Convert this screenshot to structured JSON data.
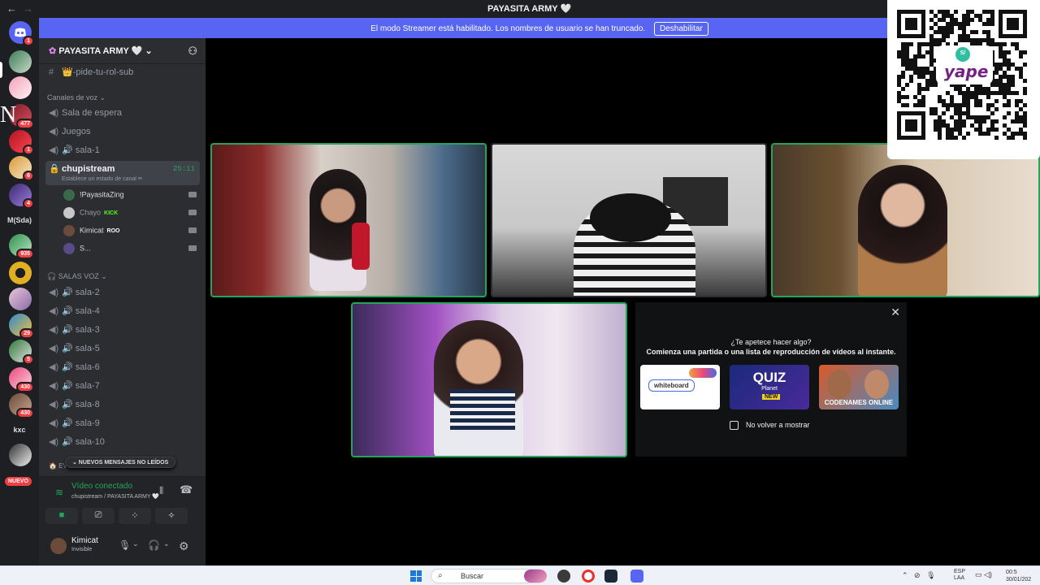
{
  "titlebar": {
    "title": "PAYASITA ARMY 🤍",
    "back": "←",
    "forward": "→"
  },
  "banner": {
    "text": "El modo Streamer está habilitado. Los nombres de usuario se han truncado.",
    "button": "Deshabilitar"
  },
  "guilds": {
    "badges": [
      "1",
      "477",
      "1",
      "6",
      "4",
      "935",
      "29",
      "5",
      "430",
      "430"
    ],
    "texts": [
      "M(Sda)",
      "kxc"
    ],
    "nuevo": "NUEVO",
    "overlay_letter": "N"
  },
  "server": {
    "name": "PAYASITA ARMY 🤍 ⌄"
  },
  "channels": {
    "top_channel": "👑-pide-tu-rol-sub",
    "category_voice": "Canales de voz ⌄",
    "waiting": "Sala de espera",
    "games": "Juegos",
    "sala1": "🔊 sala-1",
    "active": {
      "name": "chupistream",
      "status": "Establece un estado de canal ✏",
      "time": "25:11"
    },
    "users": [
      {
        "name": "!PayasitaZing",
        "tag": ""
      },
      {
        "name": "Chayo",
        "tag": "KICK"
      },
      {
        "name": "Kimicat",
        "tag": "ROO"
      },
      {
        "name": "S...",
        "tag": ""
      }
    ],
    "category_salas": "🎧 SALAS VOZ ⌄",
    "salas": [
      "🔊 sala-2",
      "🔊 sala-4",
      "🔊 sala-3",
      "🔊 sala-5",
      "🔊 sala-6",
      "🔊 sala-7",
      "🔊 sala-8",
      "🔊 sala-9",
      "🔊 sala-10"
    ],
    "unread": "⌄ NUEVOS MENSAJES NO LEÍDOS",
    "partial": "🏠 EV"
  },
  "voice": {
    "status": "Vídeo conectado",
    "location": "chupistream / PAYASITA ARMY 🤍"
  },
  "user": {
    "name": "Kimicat",
    "status": "Invisible"
  },
  "activity": {
    "question": "¿Te apetece hacer algo?",
    "description": "Comienza una partida o una lista de reproducción de vídeos al instante.",
    "cards": [
      "whiteboard",
      "QUIZ",
      "CODENAMES ONLINE"
    ],
    "card_sub": [
      "",
      "Planet",
      ""
    ],
    "card_new": "NEW",
    "checkbox_label": "No volver a mostrar",
    "close": "✕"
  },
  "qr": {
    "label": "yape",
    "currency": "S/"
  },
  "taskbar": {
    "search": "Buscar",
    "lang1": "ESP",
    "lang2": "LAA",
    "time": "00:5",
    "date": "30/01/202"
  },
  "colors": {
    "accent": "#5865f2",
    "green": "#23a55a",
    "red": "#f23f43",
    "yape": "#742284"
  }
}
